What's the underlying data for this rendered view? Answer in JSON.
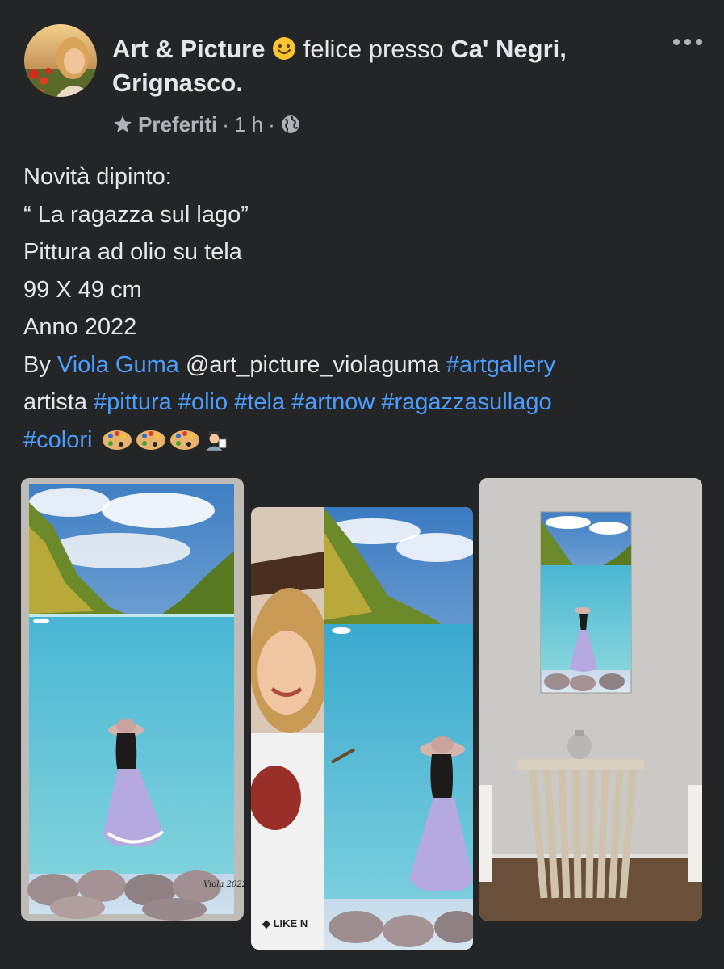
{
  "header": {
    "page_name": "Art & Picture",
    "status": "felice presso",
    "location": "Ca' Negri, Grignasco."
  },
  "meta": {
    "audience": "Preferiti",
    "separator": "·",
    "time": "1 h"
  },
  "post": {
    "lines": [
      "Novità dipinto:",
      "“ La ragazza sul lago”",
      "Pittura ad olio su tela",
      "99 X 49 cm",
      "Anno 2022"
    ],
    "by": "By",
    "author_link": "Viola Guma",
    "mention": "@art_picture_violaguma",
    "tag_artgallery": "#artgallery",
    "artista": "artista",
    "tag_pittura": "#pittura",
    "tag_olio": "#olio",
    "tag_tela": "#tela",
    "tag_artnow": "#artnow",
    "tag_ragazzasullago": "#ragazzasullago",
    "tag_colori": "#colori"
  },
  "photos": {
    "p1_signature": "Viola 2022",
    "p2_shirt_text": "◆ LIKE N"
  },
  "colors": {
    "background": "#242526",
    "text": "#e4e6eb",
    "secondary": "#b0b3b8",
    "link": "#4b9eff"
  },
  "icons": [
    "smile-emoji-icon",
    "more-icon",
    "star-icon",
    "globe-icon",
    "palette-emoji-icon",
    "artist-emoji-icon"
  ]
}
